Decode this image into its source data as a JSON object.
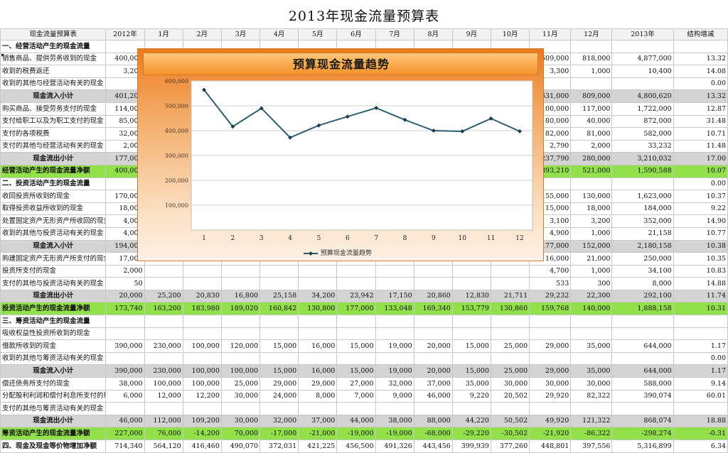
{
  "title": "2013年现金流量预算表",
  "headers": [
    "现金流量预算表",
    "2012年",
    "1月",
    "2月",
    "3月",
    "4月",
    "5月",
    "6月",
    "7月",
    "8月",
    "9月",
    "10月",
    "11月",
    "12月",
    "2013年",
    "结构增减"
  ],
  "rows": [
    {
      "type": "sec",
      "label": "一、经营活动产生的现金流量",
      "cells": [
        "",
        "",
        "",
        "",
        "",
        "",
        "",
        "",
        "",
        "",
        "",
        "",
        "",
        "",
        ""
      ]
    },
    {
      "type": "row",
      "mark": true,
      "label": "销售商品、提供劳务收到的现金",
      "cells": [
        "400,000",
        "",
        "",
        "",
        "",
        "",
        "",
        "",
        "",
        "",
        "",
        "609,000",
        "818,000",
        "4,877,000",
        "13.32"
      ]
    },
    {
      "type": "row",
      "label": "收到的税费返还",
      "cells": [
        "3,200",
        "",
        "",
        "",
        "",
        "",
        "",
        "",
        "",
        "",
        "",
        "3,300",
        "1,000",
        "10,400",
        "14.08"
      ]
    },
    {
      "type": "row",
      "label": "收到的其他与经营活动有关的现金",
      "cells": [
        "",
        "",
        "",
        "",
        "",
        "",
        "",
        "",
        "",
        "",
        "",
        "",
        "",
        "",
        "0.00"
      ]
    },
    {
      "type": "sub",
      "label": "现金流入小计",
      "cells": [
        "401,200",
        "",
        "",
        "",
        "",
        "",
        "",
        "",
        "",
        "",
        "",
        "631,000",
        "809,000",
        "4,800,620",
        "13.32"
      ]
    },
    {
      "type": "row",
      "label": "购买商品、接受劳务支付的现金",
      "cells": [
        "114,000",
        "",
        "",
        "",
        "",
        "",
        "",
        "",
        "",
        "",
        "",
        "100,000",
        "117,000",
        "1,722,000",
        "12.87"
      ]
    },
    {
      "type": "row",
      "label": "支付给职工以及为职工支付的现金",
      "cells": [
        "85,000",
        "",
        "",
        "",
        "",
        "",
        "",
        "",
        "",
        "",
        "",
        "80,000",
        "40,000",
        "872,000",
        "31.48"
      ]
    },
    {
      "type": "row",
      "label": "支付的各项税费",
      "cells": [
        "32,000",
        "",
        "",
        "",
        "",
        "",
        "",
        "",
        "",
        "",
        "",
        "82,000",
        "81,000",
        "582,000",
        "10.71"
      ]
    },
    {
      "type": "row",
      "label": "支付的其他与经营活动有关的现金",
      "cells": [
        "2,000",
        "",
        "",
        "",
        "",
        "",
        "",
        "",
        "",
        "",
        "",
        "2,790",
        "2,000",
        "33,232",
        "11.48"
      ]
    },
    {
      "type": "sub",
      "label": "现金流出小计",
      "cells": [
        "177,000",
        "",
        "",
        "",
        "",
        "",
        "",
        "",
        "",
        "",
        "",
        "237,790",
        "280,000",
        "3,210,032",
        "17.00"
      ]
    },
    {
      "type": "net",
      "label": "经营活动产生的现金流量净额",
      "cells": [
        "400,000",
        "",
        "",
        "",
        "",
        "",
        "",
        "",
        "",
        "",
        "",
        "393,210",
        "521,000",
        "1,590,588",
        "10.07"
      ]
    },
    {
      "type": "sec",
      "label": "二、投资活动产生的现金流量",
      "cells": [
        "",
        "",
        "",
        "",
        "",
        "",
        "",
        "",
        "",
        "",
        "",
        "",
        "",
        "",
        "0.00"
      ]
    },
    {
      "type": "row",
      "label": "收回投资所收到的现金",
      "cells": [
        "170,000",
        "",
        "",
        "",
        "",
        "",
        "",
        "",
        "",
        "",
        "",
        "155,000",
        "130,000",
        "1,623,000",
        "10.37"
      ]
    },
    {
      "type": "row",
      "label": "取得投资收益所收到的现金",
      "cells": [
        "18,000",
        "",
        "",
        "",
        "",
        "",
        "",
        "",
        "",
        "",
        "",
        "15,000",
        "18,000",
        "184,000",
        "9.22"
      ]
    },
    {
      "type": "row",
      "label": "处置固定资产无形资产所收回的现金",
      "cells": [
        "4,000",
        "",
        "",
        "",
        "",
        "",
        "",
        "",
        "",
        "",
        "",
        "3,100",
        "3,200",
        "352,000",
        "14.90"
      ]
    },
    {
      "type": "row",
      "label": "收到的其他与投资活动有关的现金",
      "cells": [
        "4,000",
        "",
        "",
        "",
        "",
        "",
        "",
        "",
        "",
        "",
        "",
        "4,900",
        "1,000",
        "21,158",
        "10.77"
      ]
    },
    {
      "type": "sub",
      "label": "现金流入小计",
      "cells": [
        "194,000",
        "",
        "",
        "",
        "",
        "",
        "",
        "",
        "",
        "",
        "",
        "177,000",
        "152,000",
        "2,180,158",
        "10.38"
      ]
    },
    {
      "type": "row",
      "label": "购建固定资产无形资产所支付的现金",
      "cells": [
        "17,000",
        "",
        "",
        "",
        "",
        "",
        "",
        "",
        "",
        "",
        "",
        "16,000",
        "21,000",
        "250,000",
        "10.35"
      ]
    },
    {
      "type": "row",
      "label": "投资所支付的现金",
      "cells": [
        "2,000",
        "",
        "",
        "",
        "",
        "",
        "",
        "",
        "",
        "",
        "",
        "4,700",
        "1,000",
        "34,100",
        "10.83"
      ]
    },
    {
      "type": "row",
      "label": "支付的其他与投资活动有关的现金",
      "cells": [
        "50",
        "",
        "",
        "",
        "",
        "",
        "",
        "",
        "",
        "",
        "",
        "533",
        "300",
        "8,000",
        "14.88"
      ]
    },
    {
      "type": "sub",
      "label": "现金流出小计",
      "cells": [
        "20,000",
        "25,200",
        "20,830",
        "16,800",
        "25,158",
        "34,200",
        "23,942",
        "17,150",
        "20,860",
        "12,830",
        "21,711",
        "29,232",
        "22,300",
        "292,100",
        "11.74"
      ]
    },
    {
      "type": "net",
      "label": "投资活动产生的现金流量净额",
      "cells": [
        "173,740",
        "163,200",
        "183,980",
        "189,020",
        "160,842",
        "130,800",
        "177,000",
        "133,048",
        "169,340",
        "153,779",
        "130,860",
        "159,768",
        "140,000",
        "1,888,158",
        "10.31"
      ]
    },
    {
      "type": "sec",
      "label": "三、筹资活动产生的现金流量",
      "cells": [
        "",
        "",
        "",
        "",
        "",
        "",
        "",
        "",
        "",
        "",
        "",
        "",
        "",
        "",
        ""
      ]
    },
    {
      "type": "row",
      "label": "吸收权益性投资所收到的现金",
      "cells": [
        "",
        "",
        "",
        "",
        "",
        "",
        "",
        "",
        "",
        "",
        "",
        "",
        "",
        "",
        ""
      ]
    },
    {
      "type": "row",
      "label": "借款所收到的现金",
      "cells": [
        "390,000",
        "230,000",
        "100,000",
        "120,000",
        "15,000",
        "16,000",
        "15,000",
        "19,000",
        "20,000",
        "15,000",
        "25,000",
        "29,000",
        "35,000",
        "644,000",
        "1.17"
      ]
    },
    {
      "type": "row",
      "label": "收到的其他与筹资活动有关的现金",
      "cells": [
        "",
        "",
        "",
        "",
        "",
        "",
        "",
        "",
        "",
        "",
        "",
        "",
        "",
        "",
        "0.00"
      ]
    },
    {
      "type": "sub",
      "label": "现金流入小计",
      "cells": [
        "390,000",
        "230,000",
        "100,000",
        "100,000",
        "15,000",
        "16,000",
        "15,000",
        "19,000",
        "20,000",
        "15,000",
        "25,000",
        "29,000",
        "35,000",
        "644,000",
        "1.17"
      ]
    },
    {
      "type": "row",
      "label": "偿还债务所支付的现金",
      "cells": [
        "38,000",
        "100,000",
        "100,000",
        "25,000",
        "29,000",
        "29,000",
        "27,000",
        "32,000",
        "37,000",
        "35,000",
        "30,000",
        "30,000",
        "30,000",
        "588,000",
        "9.14"
      ]
    },
    {
      "type": "row",
      "label": "分配股利利润和偿付利息所支付的现金",
      "cells": [
        "6,000",
        "12,000",
        "12,200",
        "30,000",
        "24,000",
        "8,000",
        "7,000",
        "9,000",
        "46,000",
        "9,220",
        "20,502",
        "29,920",
        "82,322",
        "390,074",
        "60.01"
      ]
    },
    {
      "type": "row",
      "label": "支付的其他与筹资活动有关的现金",
      "cells": [
        "",
        "",
        "",
        "",
        "",
        "",
        "",
        "",
        "",
        "",
        "",
        "",
        "",
        "",
        ""
      ]
    },
    {
      "type": "sub",
      "label": "现金流出小计",
      "cells": [
        "46,000",
        "112,000",
        "109,200",
        "30,000",
        "32,000",
        "37,000",
        "44,000",
        "38,000",
        "88,000",
        "44,220",
        "50,502",
        "49,920",
        "121,322",
        "868,074",
        "18.88"
      ]
    },
    {
      "type": "net",
      "label": "筹资活动产生的现金流量净额",
      "cells": [
        "227,000",
        "76,000",
        "-14,200",
        "70,000",
        "-17,000",
        "-21,000",
        "-19,000",
        "-19,000",
        "-68,000",
        "-29,220",
        "-30,502",
        "-21,920",
        "-86,322",
        "-298,274",
        "-0.31"
      ]
    },
    {
      "type": "total",
      "label": "四、现金及现金等价物增加净额",
      "cells": [
        "714,340",
        "564,120",
        "416,460",
        "490,070",
        "372,031",
        "421,225",
        "456,500",
        "491,326",
        "443,456",
        "399,939",
        "377,260",
        "448,801",
        "397,556",
        "5,316,899",
        "6.34"
      ]
    }
  ],
  "chart": {
    "title": "预算现金流量趋势",
    "legend": "预算现金流量趋势",
    "colors": {
      "line": "#2f5f6e",
      "marker": "#1f3f4a",
      "bg_top": "#ec7b1e",
      "bg_bottom": "#fdf1e6"
    }
  },
  "chart_data": {
    "type": "line",
    "title": "预算现金流量趋势",
    "x": [
      1,
      2,
      3,
      4,
      5,
      6,
      7,
      8,
      9,
      10,
      11,
      12
    ],
    "series": [
      {
        "name": "预算现金流量趋势",
        "values": [
          564120,
          416460,
          490070,
          372031,
          421225,
          456500,
          491326,
          443456,
          399939,
          397300,
          448801,
          397556
        ]
      }
    ],
    "y_ticks": [
      "100,000",
      "200,000",
      "300,000",
      "400,000",
      "500,000",
      "600,000"
    ],
    "ylim": [
      0,
      600000
    ],
    "x_tick_labels": [
      "1",
      "2",
      "3",
      "4",
      "5",
      "6",
      "7",
      "8",
      "9",
      "10",
      "11",
      "12"
    ],
    "grid": true,
    "legend_position": "bottom"
  }
}
